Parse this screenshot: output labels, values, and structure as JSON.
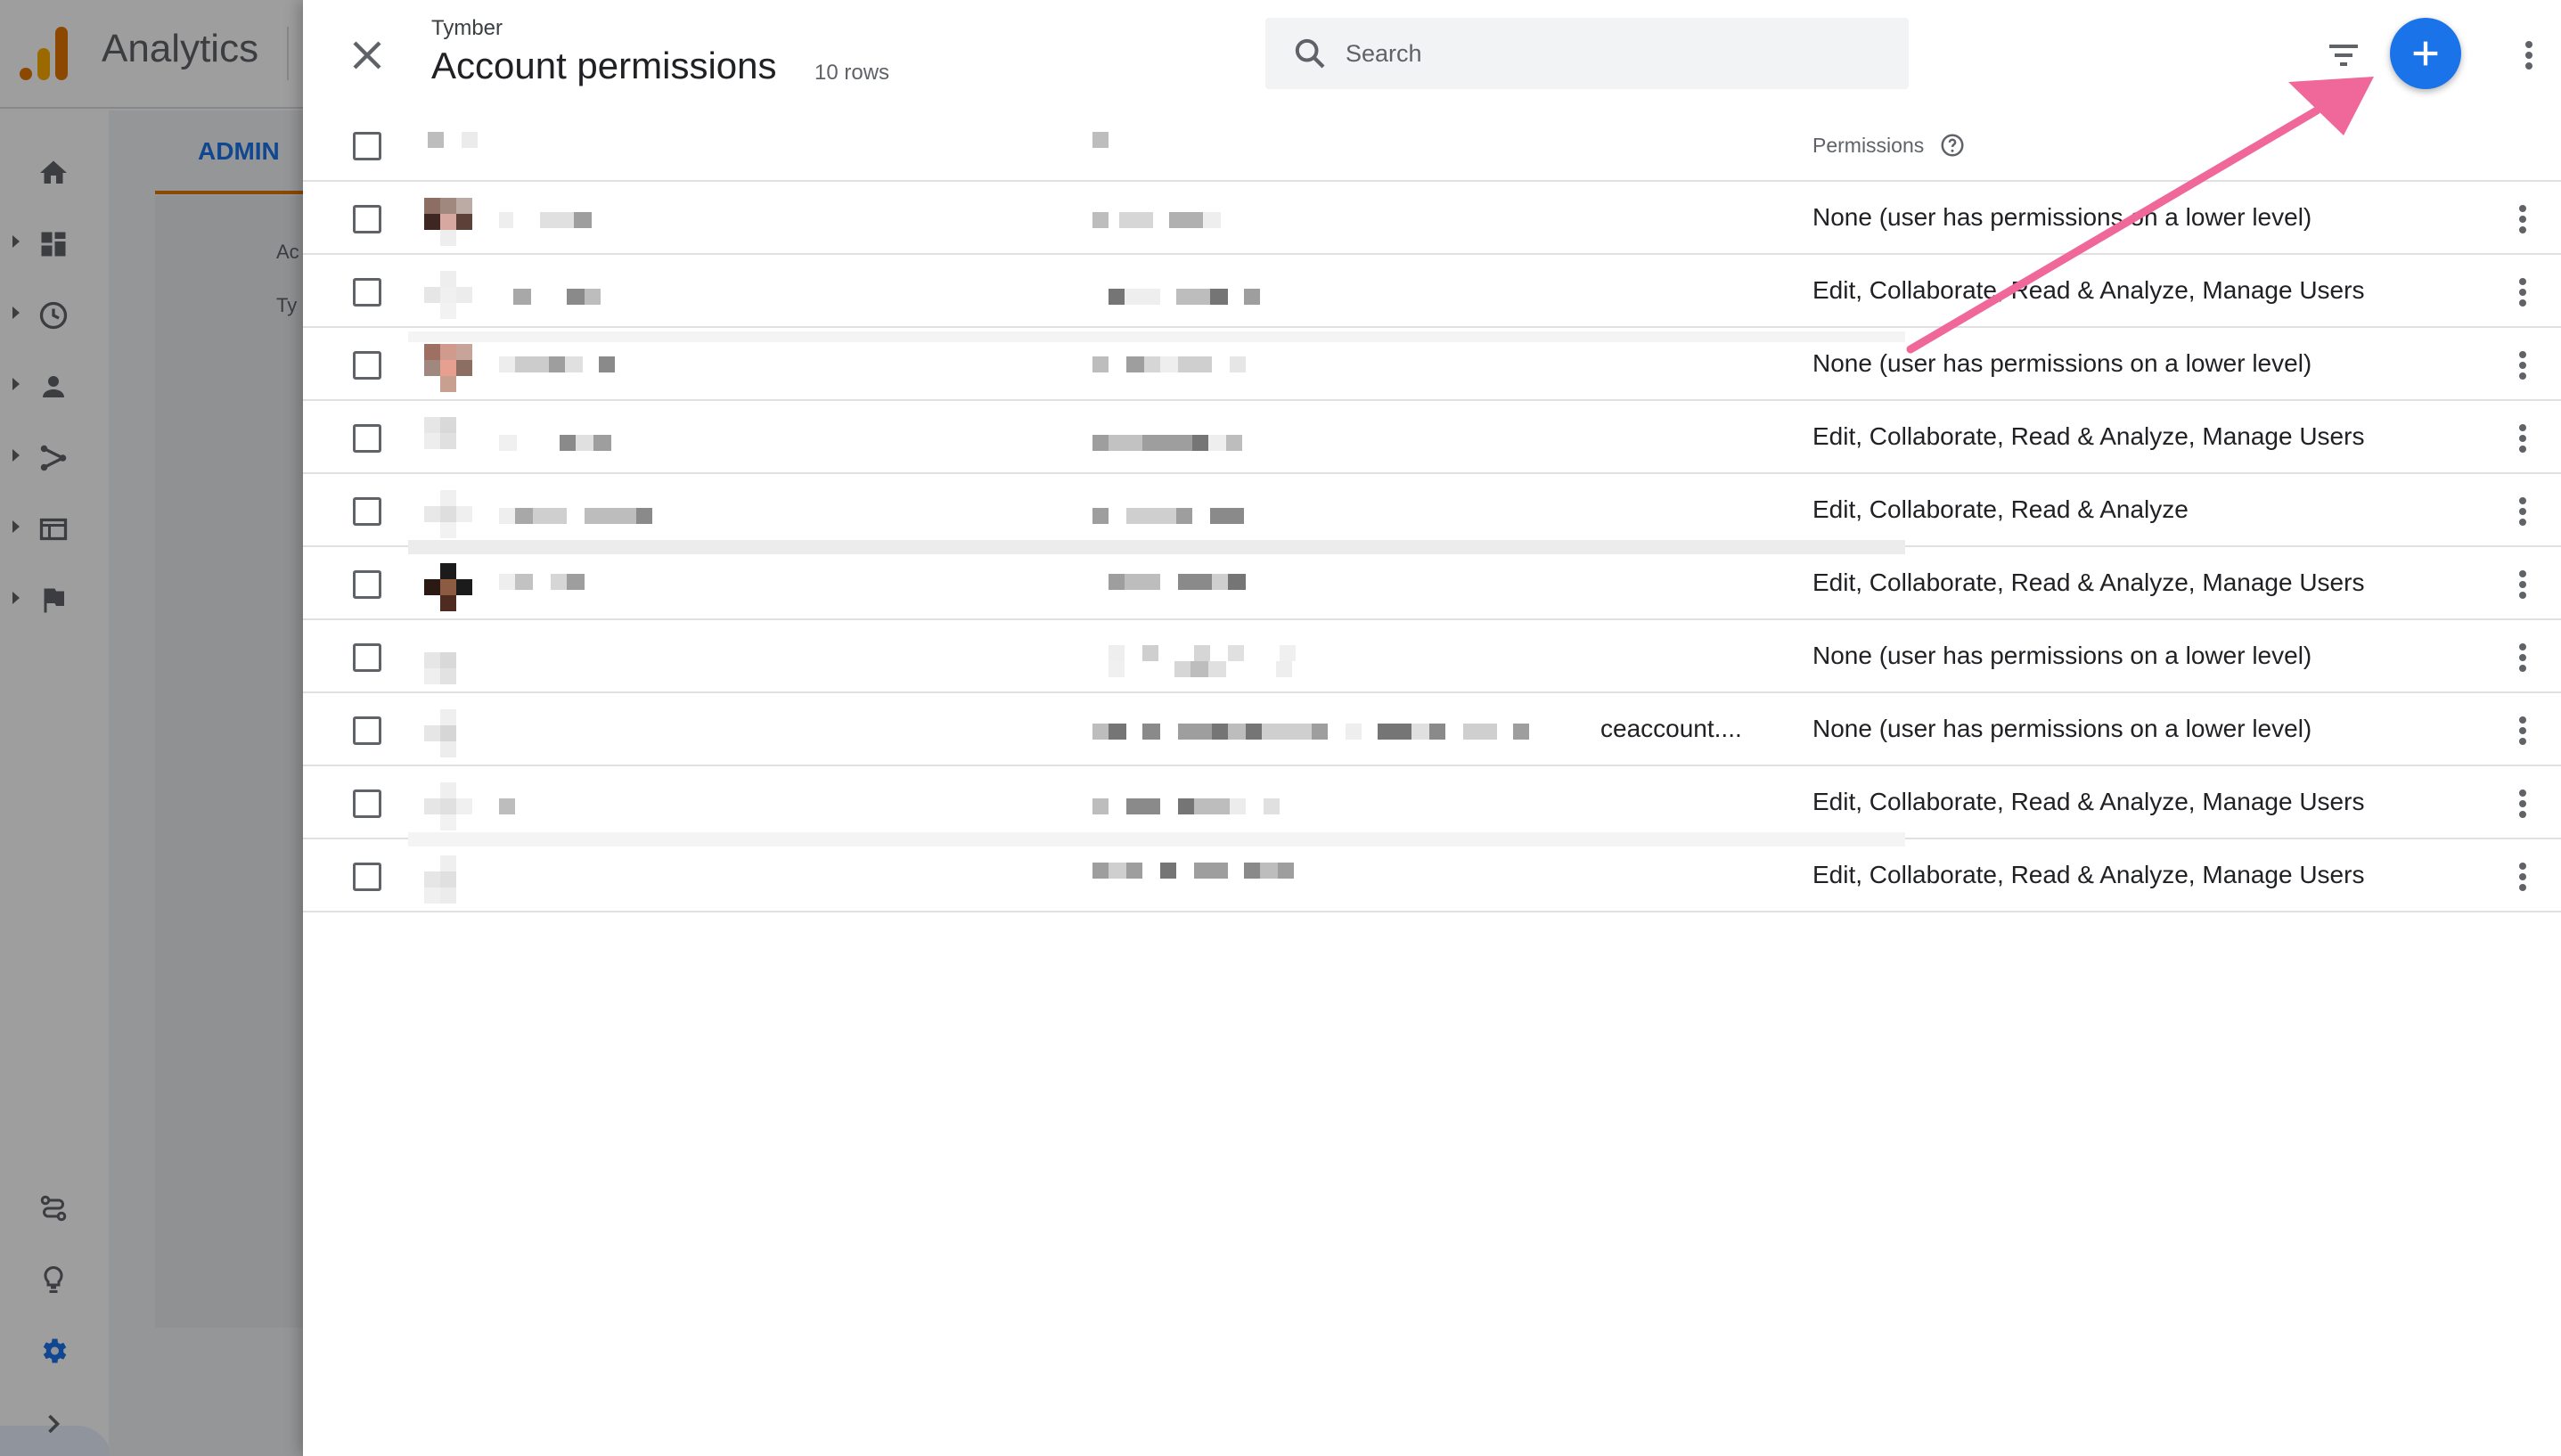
{
  "app": {
    "title": "Analytics",
    "admin_tab": "ADMIN",
    "bg_fragments": [
      "Ac",
      "Ty"
    ]
  },
  "rail": {
    "items": [
      "home-icon",
      "dashboard-icon",
      "clock-icon",
      "person-icon",
      "fork-icon",
      "display-icon",
      "flag-icon"
    ],
    "bottom": [
      "route-icon",
      "lightbulb-icon",
      "settings-icon",
      "expand-icon"
    ]
  },
  "drawer": {
    "account_name": "Tymber",
    "title": "Account permissions",
    "row_count": "10 rows",
    "search": {
      "placeholder": "Search",
      "value": ""
    },
    "icons": [
      "close-icon",
      "search-icon",
      "filter-icon",
      "add-icon",
      "more-vert-icon"
    ]
  },
  "table": {
    "permissions_header": "Permissions",
    "rows": [
      {
        "permissions": "None (user has permissions on a lower level)",
        "email_suffix": ""
      },
      {
        "permissions": "Edit, Collaborate, Read & Analyze, Manage Users",
        "email_suffix": ""
      },
      {
        "permissions": "None (user has permissions on a lower level)",
        "email_suffix": ""
      },
      {
        "permissions": "Edit, Collaborate, Read & Analyze, Manage Users",
        "email_suffix": ""
      },
      {
        "permissions": "Edit, Collaborate, Read & Analyze",
        "email_suffix": ""
      },
      {
        "permissions": "Edit, Collaborate, Read & Analyze, Manage Users",
        "email_suffix": ""
      },
      {
        "permissions": "None (user has permissions on a lower level)",
        "email_suffix": ""
      },
      {
        "permissions": "None (user has permissions on a lower level)",
        "email_suffix": "ceaccount...."
      },
      {
        "permissions": "Edit, Collaborate, Read & Analyze, Manage Users",
        "email_suffix": ""
      },
      {
        "permissions": "Edit, Collaborate, Read & Analyze, Manage Users",
        "email_suffix": ""
      }
    ]
  },
  "colors": {
    "primary": "#1a73e8",
    "analytics_orange": "#e37400",
    "analytics_yellow": "#f9ab00",
    "annotation_arrow": "#f0679a"
  }
}
